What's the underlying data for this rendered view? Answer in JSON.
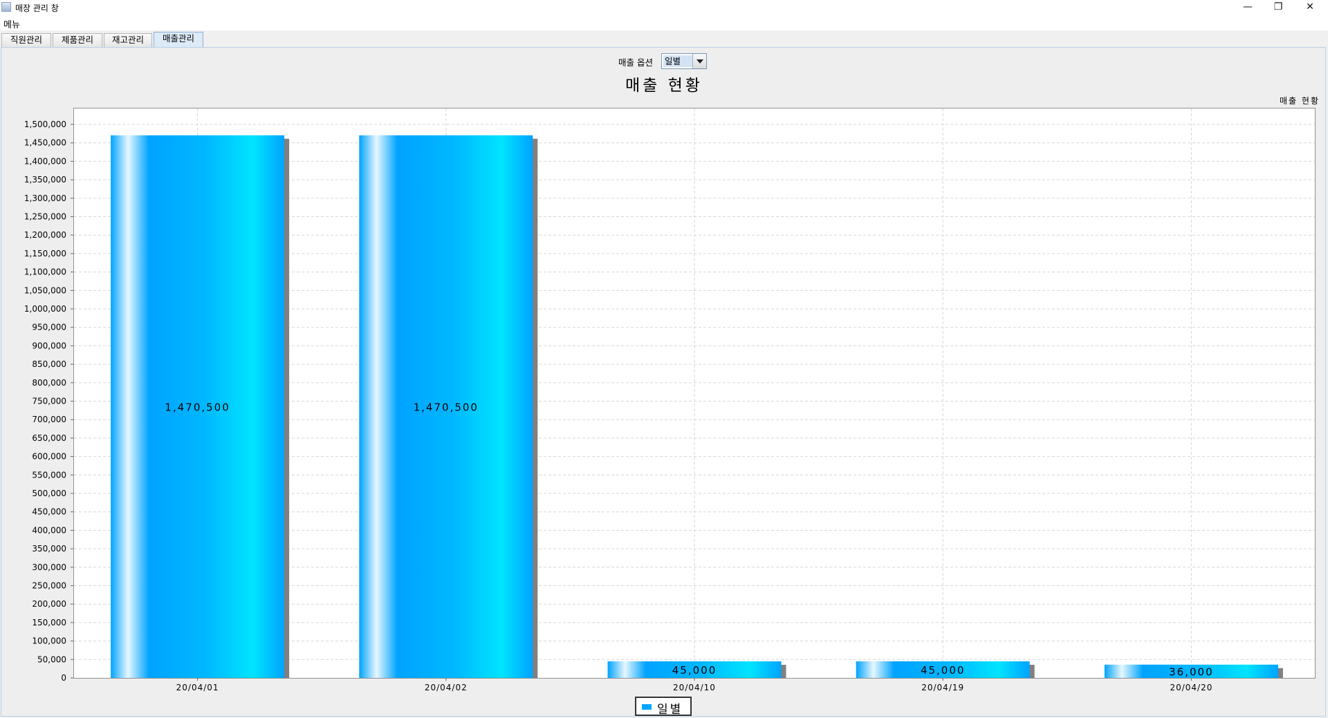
{
  "window": {
    "title": "매장 관리 창",
    "minimize_glyph": "—",
    "maximize_glyph": "❐",
    "close_glyph": "✕"
  },
  "menubar": {
    "items": [
      "메뉴"
    ]
  },
  "tabs": [
    "직원관리",
    "제품관리",
    "재고관리",
    "매출관리"
  ],
  "active_tab": "매출관리",
  "sales_option": {
    "label": "매출 옵션",
    "selected": "일별"
  },
  "chart_data": {
    "type": "bar",
    "title": "매출 현황",
    "corner_label": "매출 현황",
    "categories": [
      "20/04/01",
      "20/04/02",
      "20/04/10",
      "20/04/19",
      "20/04/20"
    ],
    "series": [
      {
        "name": "일별",
        "values": [
          1470500,
          1470500,
          45000,
          45000,
          36000
        ]
      }
    ],
    "data_labels": [
      "1,470,500",
      "1,470,500",
      "45,000",
      "45,000",
      "36,000"
    ],
    "ylim": [
      0,
      1545000
    ],
    "yticks": [
      0,
      50000,
      100000,
      150000,
      200000,
      250000,
      300000,
      350000,
      400000,
      450000,
      500000,
      550000,
      600000,
      650000,
      700000,
      750000,
      800000,
      850000,
      900000,
      950000,
      1000000,
      1050000,
      1100000,
      1150000,
      1200000,
      1250000,
      1300000,
      1350000,
      1400000,
      1450000,
      1500000
    ],
    "ytick_labels": [
      "0",
      "50,000",
      "100,000",
      "150,000",
      "200,000",
      "250,000",
      "300,000",
      "350,000",
      "400,000",
      "450,000",
      "500,000",
      "550,000",
      "600,000",
      "650,000",
      "700,000",
      "750,000",
      "800,000",
      "850,000",
      "900,000",
      "950,000",
      "1,000,000",
      "1,050,000",
      "1,100,000",
      "1,150,000",
      "1,200,000",
      "1,250,000",
      "1,300,000",
      "1,350,000",
      "1,400,000",
      "1,450,000",
      "1,500,000"
    ],
    "grid": true,
    "legend_position": "bottom-center",
    "colors": {
      "bar_light": "#e6f7ff",
      "bar_main": "#00a3ff",
      "bar_edge": "#00e4ff",
      "bar_shadow": "#808080",
      "grid": "#d6d6d6"
    }
  }
}
